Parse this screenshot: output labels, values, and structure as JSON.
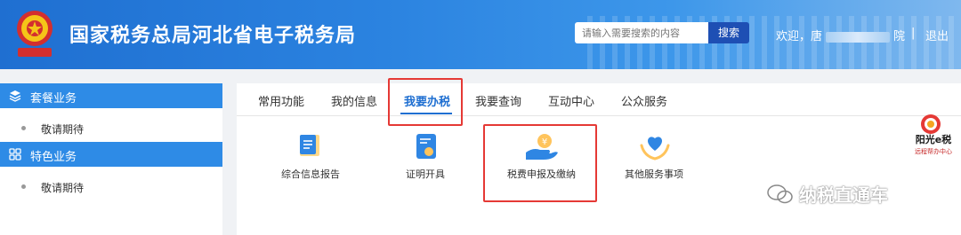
{
  "header": {
    "site_title": "国家税务总局河北省电子税务局",
    "search_placeholder": "请输入需要搜索的内容",
    "search_button": "搜索",
    "welcome_prefix": "欢迎，唐",
    "welcome_suffix": "院",
    "separator": "|",
    "logout": "退出"
  },
  "sidebar": {
    "sections": [
      {
        "label": "套餐业务",
        "icon": "layers-icon",
        "items": [
          "敬请期待"
        ]
      },
      {
        "label": "特色业务",
        "icon": "grid-icon",
        "items": [
          "敬请期待"
        ]
      }
    ]
  },
  "tabs": [
    "常用功能",
    "我的信息",
    "我要办税",
    "我要查询",
    "互动中心",
    "公众服务"
  ],
  "active_tab": "我要办税",
  "services": [
    {
      "label": "综合信息报告",
      "icon": "report-icon"
    },
    {
      "label": "证明开具",
      "icon": "certificate-icon"
    },
    {
      "label": "税费申报及缴纳",
      "icon": "tax-payment-icon"
    },
    {
      "label": "其他服务事项",
      "icon": "heart-hands-icon"
    }
  ],
  "brand": {
    "line1": "阳光e税",
    "line2": "远程帮办中心"
  },
  "watermark": "纳税直通车",
  "colors": {
    "primary": "#1f6fd1",
    "sidebar_header": "#2e8be6",
    "highlight_box": "#e53935",
    "search_button": "#1e4fb4"
  }
}
